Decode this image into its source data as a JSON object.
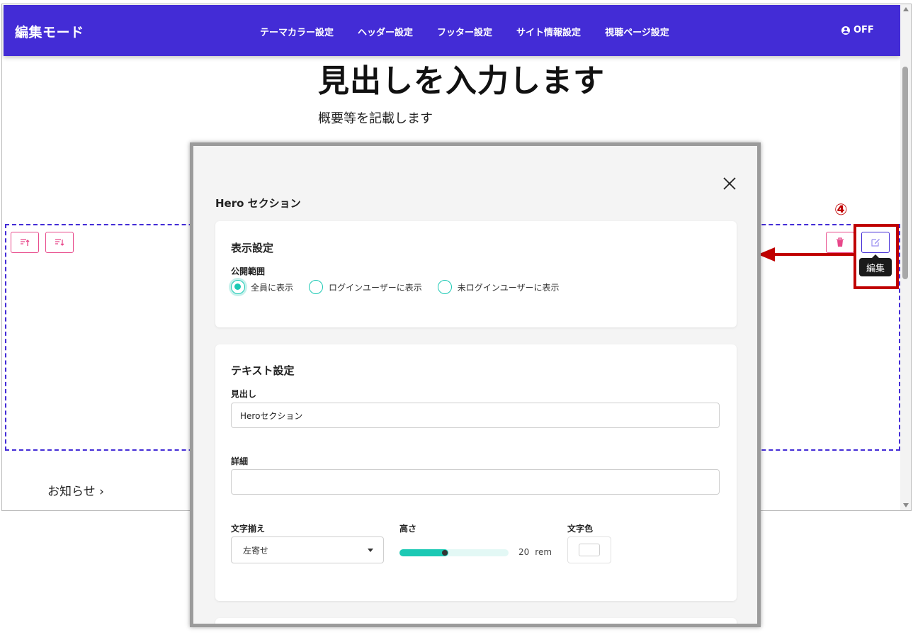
{
  "header": {
    "brand": "編集モード",
    "nav": [
      "テーマカラー設定",
      "ヘッダー設定",
      "フッター設定",
      "サイト情報設定",
      "視聴ページ設定"
    ],
    "mode_label": "OFF"
  },
  "hero": {
    "title": "見出しを入力します",
    "description": "概要等を記載します"
  },
  "news_link": "お知らせ",
  "annotation": {
    "step": "④",
    "tooltip": "編集"
  },
  "modal": {
    "title": "Hero セクション",
    "display_settings": {
      "title": "表示設定",
      "visibility_label": "公開範囲",
      "options": [
        "全員に表示",
        "ログインユーザーに表示",
        "未ログインユーザーに表示"
      ],
      "selected": "全員に表示"
    },
    "text_settings": {
      "title": "テキスト設定",
      "heading_label": "見出し",
      "heading_value": "Heroセクション",
      "detail_label": "詳細",
      "detail_value": "",
      "align_label": "文字揃え",
      "align_value": "左寄せ",
      "height_label": "高さ",
      "height_value": "20",
      "height_unit": "rem",
      "height_slider_fraction": 0.45,
      "color_label": "文字色"
    }
  },
  "colors": {
    "header_bg": "#432cd6",
    "accent_teal": "#1cc9b4",
    "danger_pink": "#e8488a",
    "annotation_red": "#c00000"
  }
}
